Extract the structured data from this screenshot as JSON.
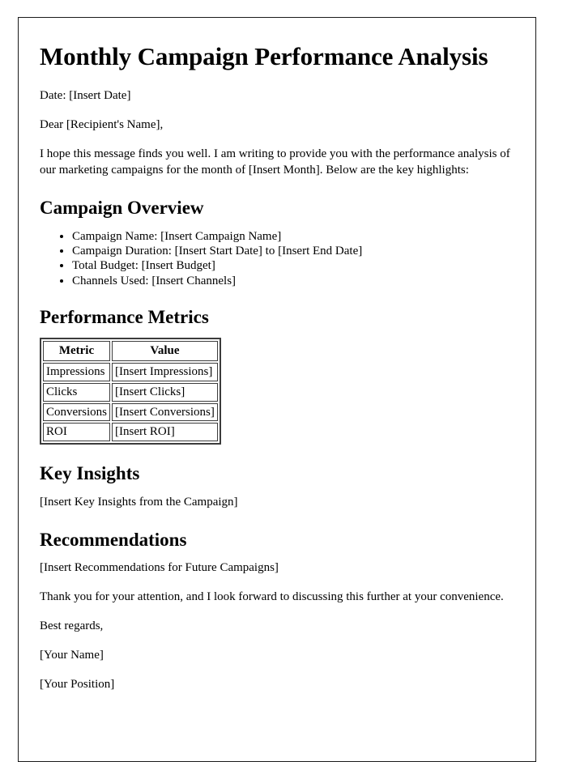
{
  "document": {
    "title": "Monthly Campaign Performance Analysis",
    "date_line": "Date: [Insert Date]",
    "salutation": "Dear [Recipient's Name],",
    "intro_paragraph": "I hope this message finds you well. I am writing to provide you with the performance analysis of our marketing campaigns for the month of [Insert Month]. Below are the key highlights:",
    "sections": {
      "campaign_overview": {
        "heading": "Campaign Overview",
        "items": [
          "Campaign Name: [Insert Campaign Name]",
          "Campaign Duration: [Insert Start Date] to [Insert End Date]",
          "Total Budget: [Insert Budget]",
          "Channels Used: [Insert Channels]"
        ]
      },
      "performance_metrics": {
        "heading": "Performance Metrics",
        "table": {
          "columns": [
            "Metric",
            "Value"
          ],
          "rows": [
            [
              "Impressions",
              "[Insert Impressions]"
            ],
            [
              "Clicks",
              "[Insert Clicks]"
            ],
            [
              "Conversions",
              "[Insert Conversions]"
            ],
            [
              "ROI",
              "[Insert ROI]"
            ]
          ]
        }
      },
      "key_insights": {
        "heading": "Key Insights",
        "body": "[Insert Key Insights from the Campaign]"
      },
      "recommendations": {
        "heading": "Recommendations",
        "body": "[Insert Recommendations for Future Campaigns]"
      }
    },
    "closing_paragraph": "Thank you for your attention, and I look forward to discussing this further at your convenience.",
    "sign_off": "Best regards,",
    "signature_name": "[Your Name]",
    "signature_position": "[Your Position]"
  }
}
